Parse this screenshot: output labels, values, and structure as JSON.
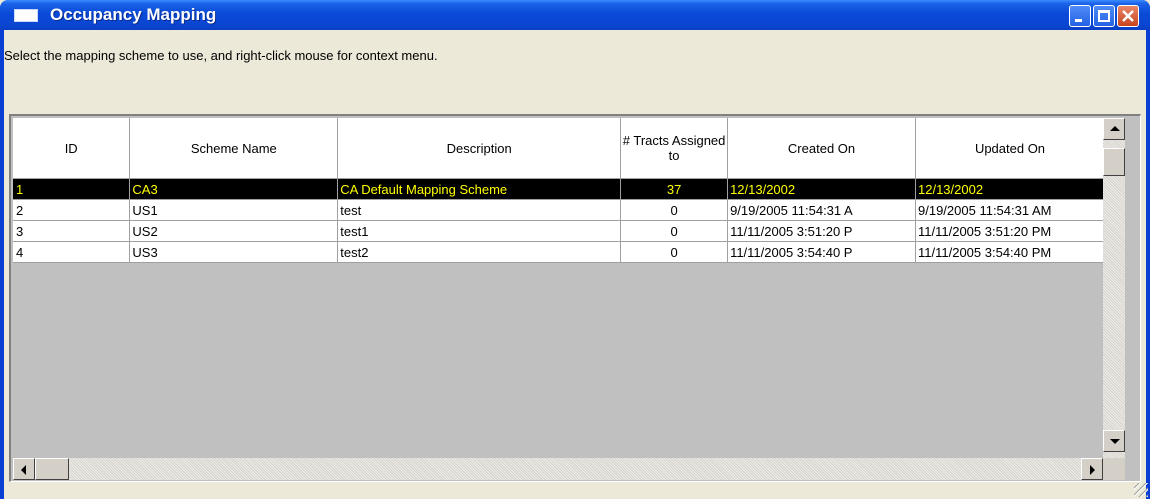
{
  "window": {
    "title": "Occupancy Mapping"
  },
  "instruction": "Select the mapping scheme to use, and right-click mouse for context menu.",
  "grid": {
    "columns": [
      {
        "key": "id",
        "label": "ID"
      },
      {
        "key": "scheme_name",
        "label": "Scheme Name"
      },
      {
        "key": "description",
        "label": "Description"
      },
      {
        "key": "tracts",
        "label": "# Tracts Assigned to"
      },
      {
        "key": "created_on",
        "label": "Created On"
      },
      {
        "key": "updated_on",
        "label": "Updated On"
      }
    ],
    "rows": [
      {
        "id": "1",
        "scheme_name": "CA3",
        "description": "CA Default Mapping Scheme",
        "tracts": "37",
        "created_on": "12/13/2002",
        "updated_on": "12/13/2002",
        "selected": true
      },
      {
        "id": "2",
        "scheme_name": "US1",
        "description": "test",
        "tracts": "0",
        "created_on": "9/19/2005 11:54:31 A",
        "updated_on": "9/19/2005 11:54:31 AM",
        "selected": false
      },
      {
        "id": "3",
        "scheme_name": "US2",
        "description": "test1",
        "tracts": "0",
        "created_on": "11/11/2005 3:51:20 P",
        "updated_on": "11/11/2005 3:51:20 PM",
        "selected": false
      },
      {
        "id": "4",
        "scheme_name": "US3",
        "description": "test2",
        "tracts": "0",
        "created_on": "11/11/2005 3:54:40 P",
        "updated_on": "11/11/2005 3:54:40 PM",
        "selected": false
      }
    ]
  },
  "colors": {
    "titlebar": "#0a46d2",
    "selected_row_bg": "#000000",
    "selected_row_text": "#ffff00"
  },
  "icons": [
    "window-icon",
    "minimize-icon",
    "maximize-icon",
    "close-icon",
    "scroll-up-arrow-icon",
    "scroll-down-arrow-icon",
    "scroll-left-arrow-icon",
    "scroll-right-arrow-icon",
    "resize-grip-icon"
  ]
}
